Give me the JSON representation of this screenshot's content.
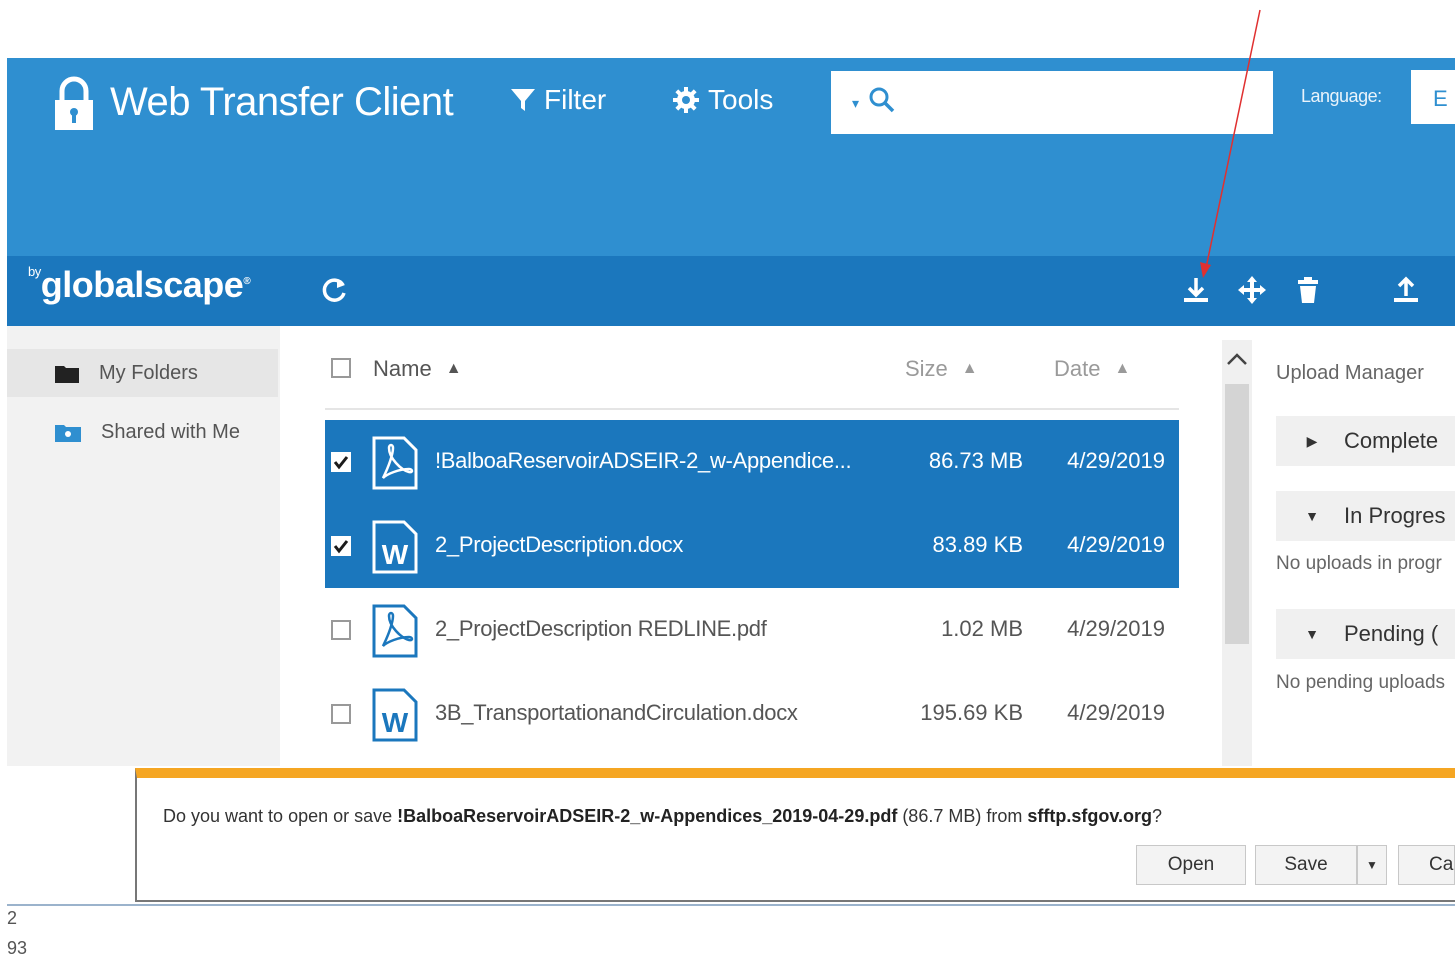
{
  "header": {
    "title": "Web Transfer Client",
    "filter_label": "Filter",
    "tools_label": "Tools",
    "search_placeholder": "",
    "language_label": "Language:",
    "language_value": "E"
  },
  "toolbar": {
    "brand_by": "by",
    "brand_name": "globalscape",
    "brand_mark": "®"
  },
  "sidebar": {
    "items": [
      {
        "label": "My Folders"
      },
      {
        "label": "Shared with Me"
      }
    ]
  },
  "file_list": {
    "columns": {
      "name": "Name",
      "size": "Size",
      "date": "Date"
    },
    "rows": [
      {
        "name": "!BalboaReservoirADSEIR-2_w-Appendice...",
        "size": "86.73 MB",
        "date": "4/29/2019",
        "type": "pdf",
        "selected": true
      },
      {
        "name": "2_ProjectDescription.docx",
        "size": "83.89 KB",
        "date": "4/29/2019",
        "type": "docx",
        "selected": true
      },
      {
        "name": "2_ProjectDescription REDLINE.pdf",
        "size": "1.02 MB",
        "date": "4/29/2019",
        "type": "pdf",
        "selected": false
      },
      {
        "name": "3B_TransportationandCirculation.docx",
        "size": "195.69 KB",
        "date": "4/29/2019",
        "type": "docx",
        "selected": false
      }
    ]
  },
  "upload_manager": {
    "title": "Upload Manager",
    "completed_label": "Complete",
    "in_progress_label": "In Progres",
    "in_progress_note": "No uploads in progr",
    "pending_label": "Pending (",
    "pending_note": "No pending uploads"
  },
  "dialog": {
    "prefix": "Do you want to open or save ",
    "file": "!BalboaReservoirADSEIR-2_w-Appendices_2019-04-29.pdf",
    "size": " (86.7 MB) from ",
    "host": "sfftp.sfgov.org",
    "suffix": "?",
    "open_label": "Open",
    "save_label": "Save",
    "cancel_label": "Ca"
  },
  "footer": {
    "line1": "2",
    "line2": "93"
  },
  "colors": {
    "header": "#2f8fd0",
    "toolbar": "#1b77bd",
    "selection": "#1b77bd",
    "dialog_accent": "#f5a623",
    "annotation_arrow": "#e03030"
  }
}
